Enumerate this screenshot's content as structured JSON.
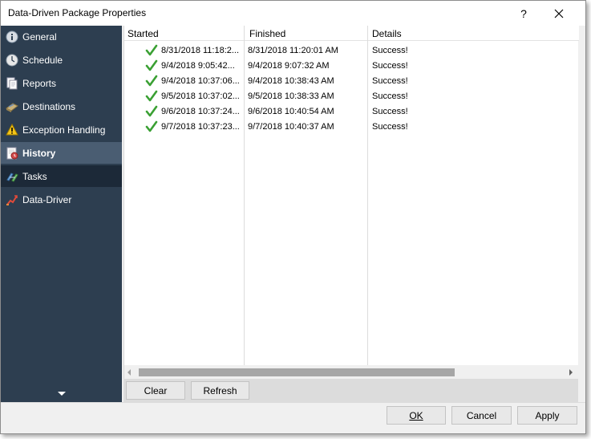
{
  "window": {
    "title": "Data-Driven Package Properties"
  },
  "titlebar": {
    "help_label": "?"
  },
  "sidebar": {
    "items": [
      {
        "label": "General",
        "icon": "info-icon"
      },
      {
        "label": "Schedule",
        "icon": "clock-icon"
      },
      {
        "label": "Reports",
        "icon": "reports-icon"
      },
      {
        "label": "Destinations",
        "icon": "destinations-icon"
      },
      {
        "label": "Exception Handling",
        "icon": "warning-icon"
      },
      {
        "label": "History",
        "icon": "history-icon",
        "selected": true
      },
      {
        "label": "Tasks",
        "icon": "tasks-icon"
      },
      {
        "label": "Data-Driver",
        "icon": "data-driver-icon"
      }
    ]
  },
  "history": {
    "columns": [
      "Started",
      "Finished",
      "Details"
    ],
    "rows": [
      {
        "started": "8/31/2018 11:18:2...",
        "finished": "8/31/2018 11:20:01 AM",
        "details": "Success!"
      },
      {
        "started": "9/4/2018 9:05:42...",
        "finished": "9/4/2018 9:07:32 AM",
        "details": "Success!"
      },
      {
        "started": "9/4/2018 10:37:06...",
        "finished": "9/4/2018 10:38:43 AM",
        "details": "Success!"
      },
      {
        "started": "9/5/2018 10:37:02...",
        "finished": "9/5/2018 10:38:33 AM",
        "details": "Success!"
      },
      {
        "started": "9/6/2018 10:37:24...",
        "finished": "9/6/2018 10:40:54 AM",
        "details": "Success!"
      },
      {
        "started": "9/7/2018 10:37:23...",
        "finished": "9/7/2018 10:40:37 AM",
        "details": "Success!"
      }
    ]
  },
  "actions": {
    "clear_label": "Clear",
    "refresh_label": "Refresh"
  },
  "footer": {
    "ok_label": "OK",
    "cancel_label": "Cancel",
    "apply_label": "Apply"
  },
  "colors": {
    "sidebar_bg": "#2d3e50",
    "selected_bg": "#4a5d72",
    "check_green": "#3aa033"
  }
}
